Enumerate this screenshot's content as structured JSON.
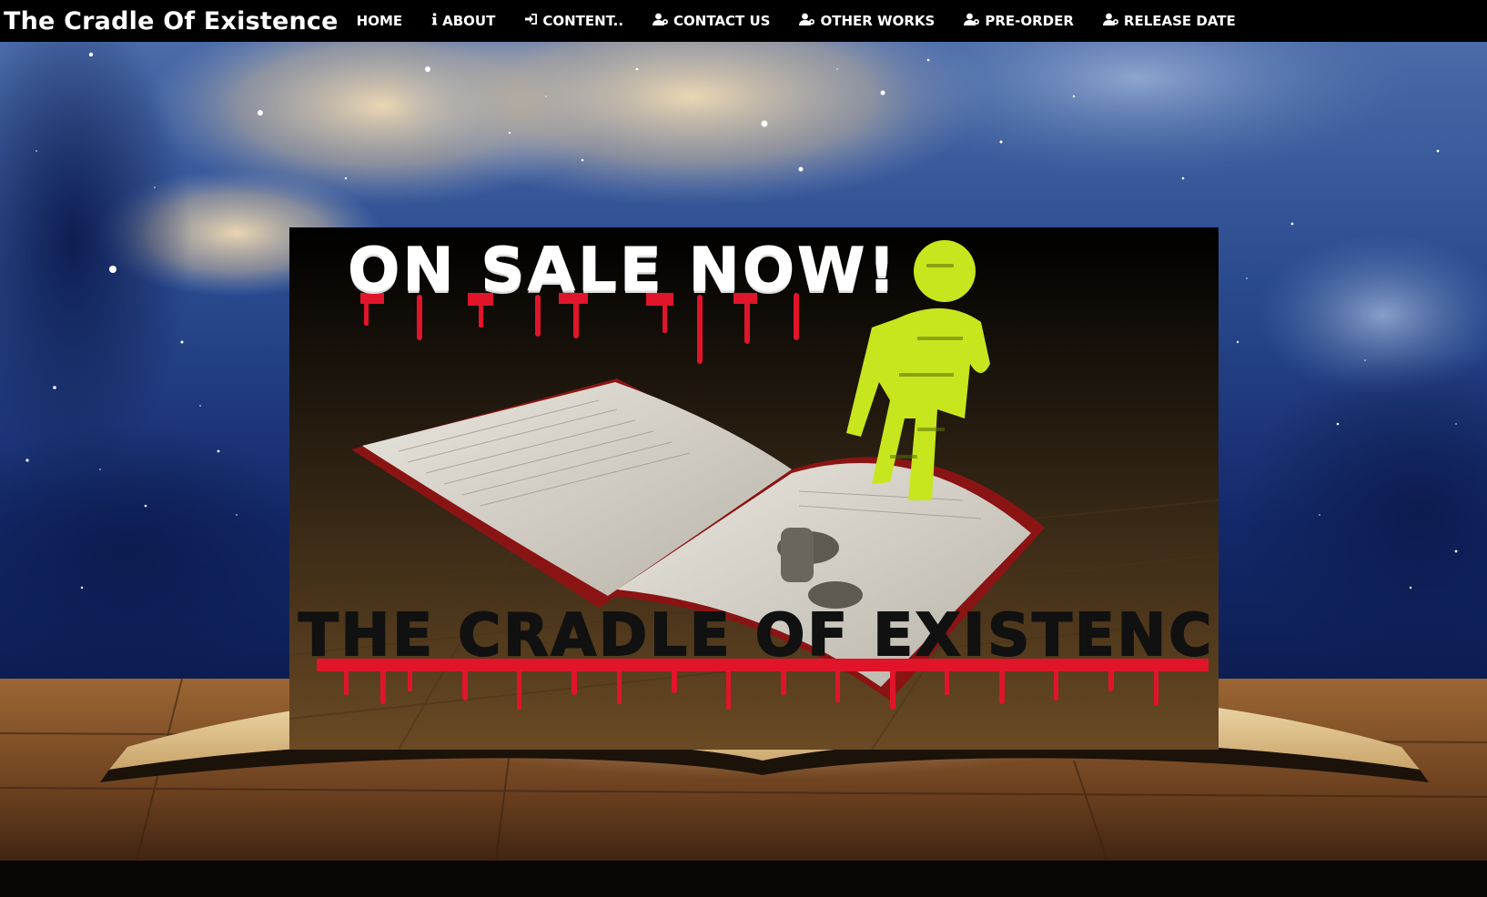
{
  "site": {
    "title": "The Cradle Of Existence"
  },
  "nav": {
    "items": [
      {
        "label": "HOME",
        "icon": ""
      },
      {
        "label": "ABOUT",
        "icon": "info-icon"
      },
      {
        "label": "CONTENT..",
        "icon": "sign-in-icon"
      },
      {
        "label": "CONTACT US",
        "icon": "user-icon"
      },
      {
        "label": "OTHER WORKS",
        "icon": "user-icon"
      },
      {
        "label": "PRE-ORDER",
        "icon": "user-icon"
      },
      {
        "label": "RELEASE DATE",
        "icon": "user-icon"
      }
    ]
  },
  "poster": {
    "headline": "ON SALE NOW!",
    "book_title": "THE CRADLE OF EXISTENCE"
  },
  "colors": {
    "navbar": "#000000",
    "blood": "#e0152a",
    "figure": "#c8e61e",
    "sky": "#1b2f6b",
    "wood": "#7a4a22"
  }
}
